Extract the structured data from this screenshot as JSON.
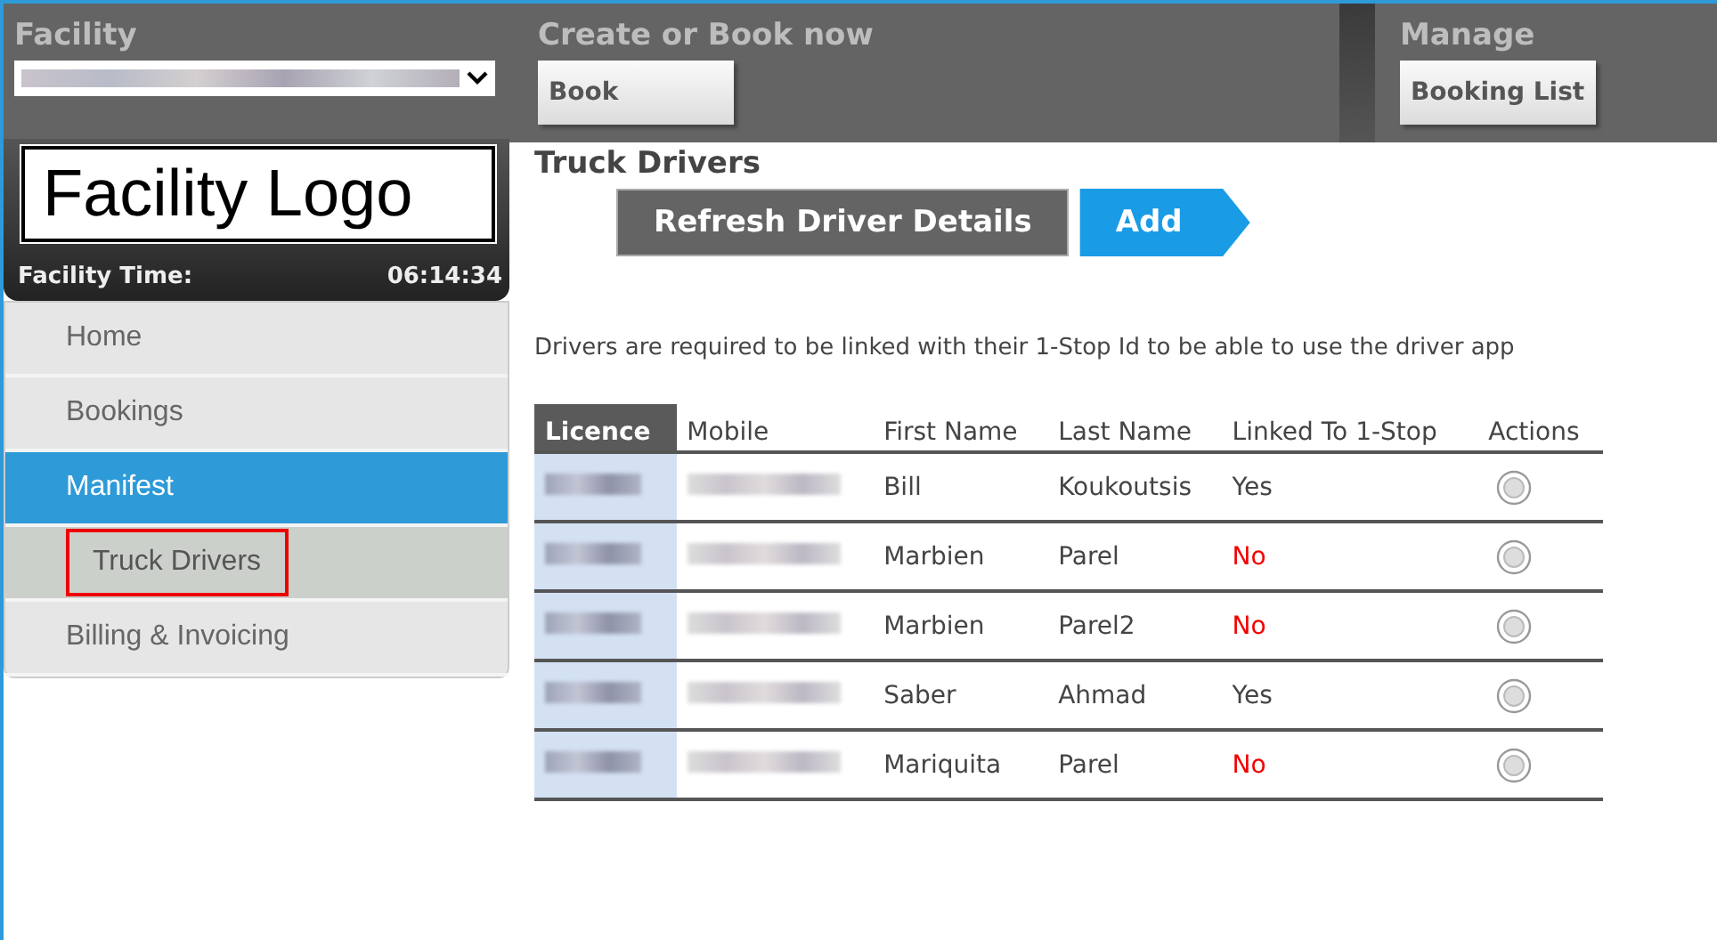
{
  "header": {
    "facility": {
      "label": "Facility"
    },
    "create": {
      "label": "Create or Book now",
      "button": "Book"
    },
    "manage": {
      "label": "Manage",
      "button": "Booking List"
    }
  },
  "logo": {
    "text": "Facility Logo"
  },
  "facility_time": {
    "label": "Facility Time:",
    "value": "06:14:34"
  },
  "sidebar": {
    "items": [
      {
        "label": "Home",
        "selected": false
      },
      {
        "label": "Bookings",
        "selected": false
      },
      {
        "label": "Manifest",
        "selected": true,
        "children": [
          {
            "label": "Truck Drivers",
            "selected": true
          }
        ]
      },
      {
        "label": "Billing & Invoicing",
        "selected": false
      }
    ]
  },
  "page": {
    "title": "Truck Drivers",
    "buttons": [
      {
        "label": "Refresh Driver Details",
        "kind": "plain"
      },
      {
        "label": "Add",
        "kind": "arrow"
      }
    ],
    "note": "Drivers are required to be linked with their 1-Stop Id to be able to use the driver app"
  },
  "table": {
    "columns": [
      "Licence",
      "Mobile",
      "First Name",
      "Last Name",
      "Linked To 1-Stop",
      "Actions"
    ],
    "rows": [
      {
        "first_name": "Bill",
        "last_name": "Koukoutsis",
        "linked": "Yes",
        "is_linked": true,
        "selected": false
      },
      {
        "first_name": "Marbien",
        "last_name": "Parel",
        "linked": "No",
        "is_linked": false,
        "selected": false
      },
      {
        "first_name": "Marbien",
        "last_name": "Parel2",
        "linked": "No",
        "is_linked": false,
        "selected": false
      },
      {
        "first_name": "Saber",
        "last_name": "Ahmad",
        "linked": "Yes",
        "is_linked": true,
        "selected": false
      },
      {
        "first_name": "Mariquita",
        "last_name": "Parel",
        "linked": "No",
        "is_linked": false,
        "selected": false
      }
    ]
  }
}
